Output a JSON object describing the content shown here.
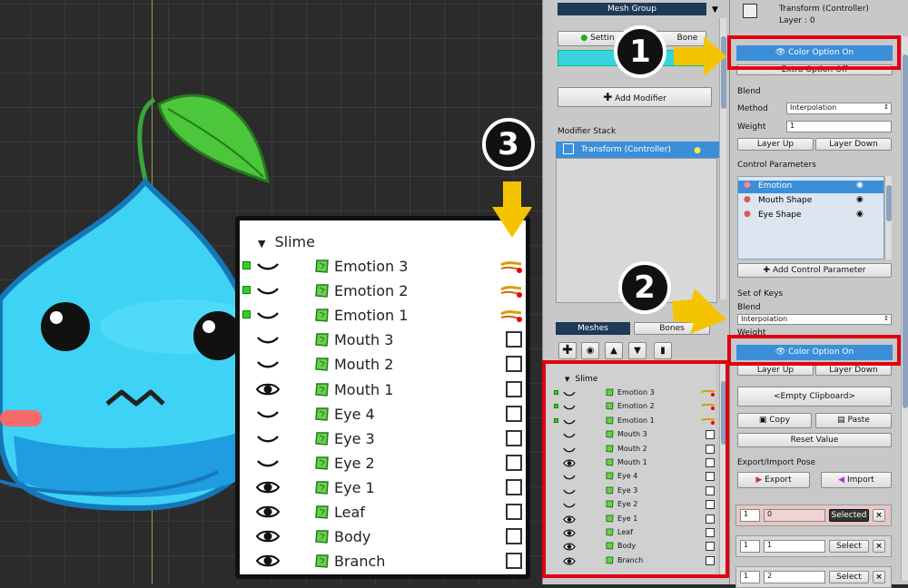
{
  "zoom_panel": {
    "group": "Slime",
    "rows": [
      {
        "name": "Emotion 3",
        "vis": "line",
        "ctrl": true,
        "green": true
      },
      {
        "name": "Emotion 2",
        "vis": "line",
        "ctrl": true,
        "green": true
      },
      {
        "name": "Emotion 1",
        "vis": "line",
        "ctrl": true,
        "green": true
      },
      {
        "name": "Mouth 3",
        "vis": "line",
        "ctrl": false,
        "green": false
      },
      {
        "name": "Mouth 2",
        "vis": "line",
        "ctrl": false,
        "green": false
      },
      {
        "name": "Mouth 1",
        "vis": "eye",
        "ctrl": false,
        "green": false
      },
      {
        "name": "Eye 4",
        "vis": "line",
        "ctrl": false,
        "green": false
      },
      {
        "name": "Eye 3",
        "vis": "line",
        "ctrl": false,
        "green": false
      },
      {
        "name": "Eye 2",
        "vis": "line",
        "ctrl": false,
        "green": false
      },
      {
        "name": "Eye 1",
        "vis": "eye",
        "ctrl": false,
        "green": false
      },
      {
        "name": "Leaf",
        "vis": "eye",
        "ctrl": false,
        "green": false
      },
      {
        "name": "Body",
        "vis": "eye",
        "ctrl": false,
        "green": false
      },
      {
        "name": "Branch",
        "vis": "eye",
        "ctrl": false,
        "green": false
      }
    ]
  },
  "callouts": {
    "one": "1",
    "two": "2",
    "three": "3"
  },
  "mid": {
    "mesh_group_label": "Mesh Group",
    "settings_tab": "Settin",
    "bone_tab": "Bone",
    "add_modifier": "Add Modifier",
    "modifier_stack": "Modifier Stack",
    "modifier_item": "Transform (Controller)",
    "meshes_tab": "Meshes",
    "bones_tab": "Bones"
  },
  "right": {
    "title": "Transform (Controller)",
    "layer": "Layer : 0",
    "color_option": "Color Option On",
    "extra_option": "Extra Option Off",
    "blend": "Blend",
    "method_label": "Method",
    "method_value": "Interpolation",
    "weight_label": "Weight",
    "weight_value": "1",
    "layer_up": "Layer Up",
    "layer_down": "Layer Down",
    "control_params": "Control Parameters",
    "params": [
      "Emotion",
      "Mouth Shape",
      "Eye Shape"
    ],
    "add_control_param": "Add Control Parameter",
    "set_of_keys": "Set of Keys",
    "blend2": "Blend",
    "blend2_value": "Interpolation",
    "weight2": "Weight",
    "color_option2": "Color Option On",
    "layer_up2": "Layer Up",
    "layer_down2": "Layer Down",
    "empty_clipboard": "<Empty Clipboard>",
    "copy": "Copy",
    "paste": "Paste",
    "reset_value": "Reset Value",
    "export_import": "Export/Import Pose",
    "export": "Export",
    "import": "Import",
    "keys": [
      {
        "idx": "1",
        "val": "0",
        "btn": "Selected"
      },
      {
        "idx": "1",
        "val": "1",
        "btn": "Select"
      },
      {
        "idx": "1",
        "val": "2",
        "btn": "Select"
      }
    ],
    "close": "×"
  },
  "colors": {
    "accent": "#3b8fd8",
    "highlight_red": "#e00010",
    "arrow": "#f5c400"
  }
}
